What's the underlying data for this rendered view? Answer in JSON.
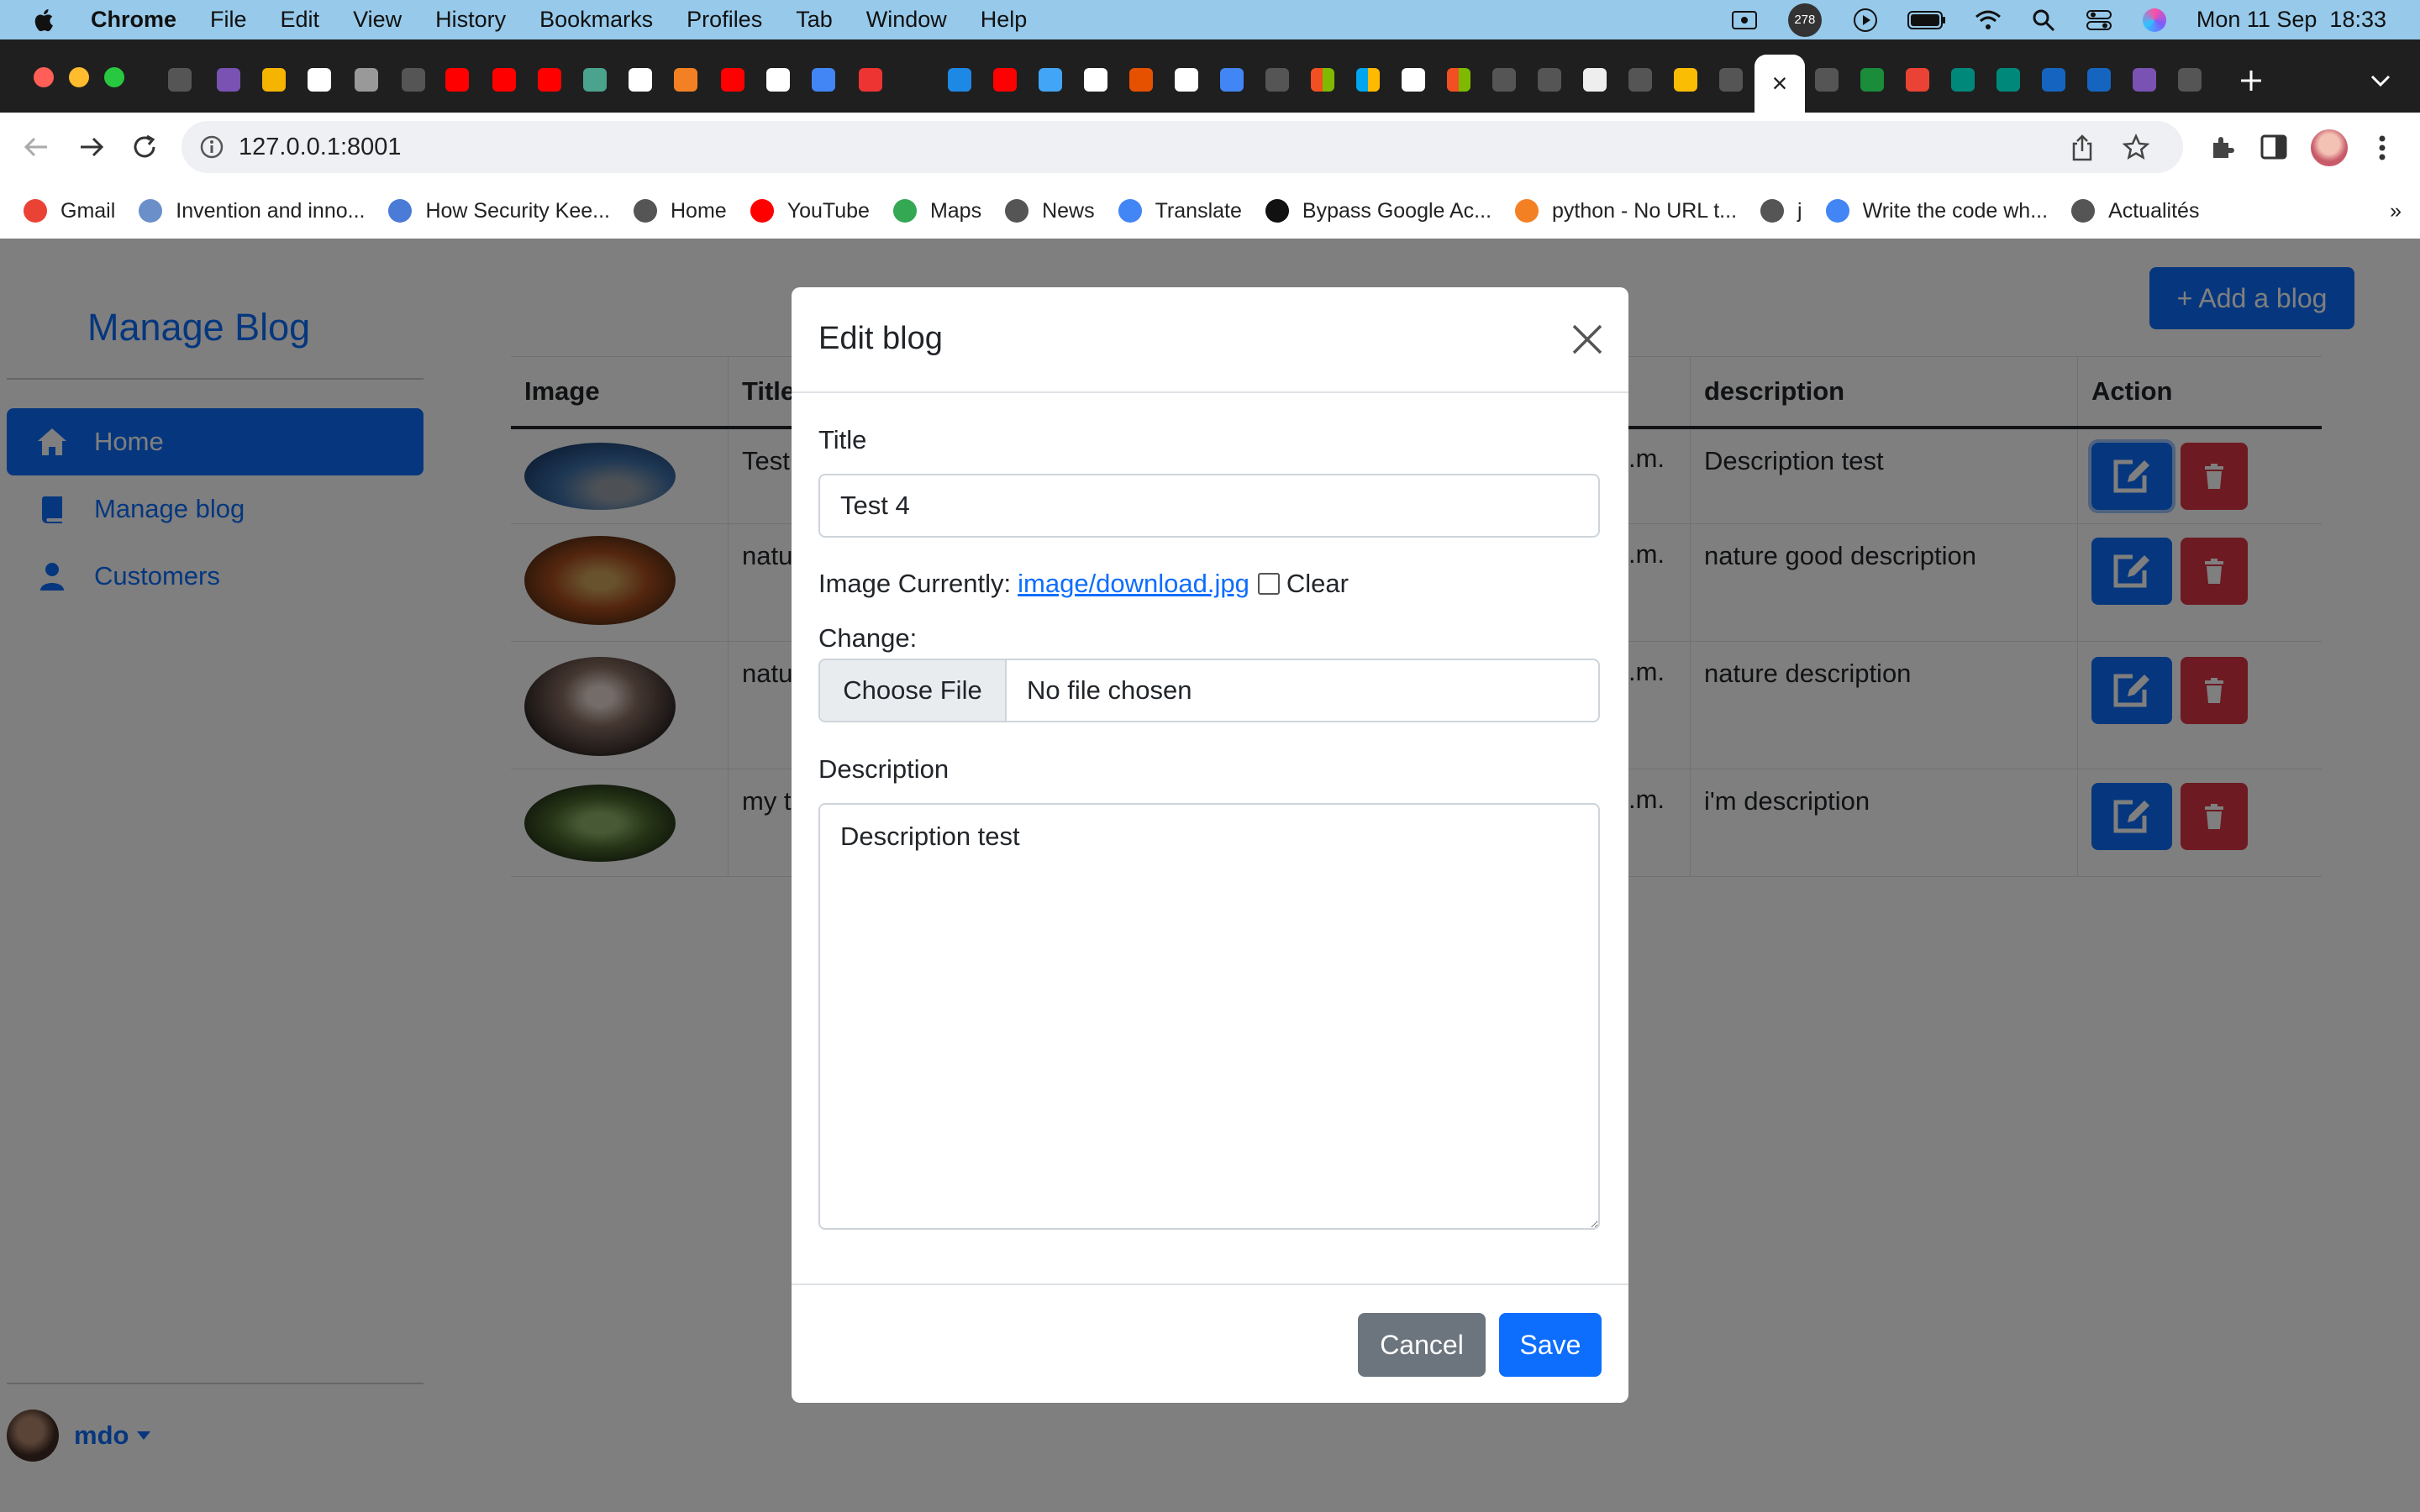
{
  "menubar": {
    "items": [
      "Chrome",
      "File",
      "Edit",
      "View",
      "History",
      "Bookmarks",
      "Profiles",
      "Tab",
      "Window",
      "Help"
    ],
    "badge": "278",
    "datetime": "Mon 11 Sep  18:33"
  },
  "browser": {
    "url": "127.0.0.1:8001",
    "active_tab_close": "×"
  },
  "bookmarks": [
    {
      "label": "Gmail",
      "color": "#ea4335"
    },
    {
      "label": "Invention and inno...",
      "color": "#6a8fc9"
    },
    {
      "label": "How Security Kee...",
      "color": "#4a7bd6"
    },
    {
      "label": "Home",
      "color": "#555"
    },
    {
      "label": "YouTube",
      "color": "#ff0000"
    },
    {
      "label": "Maps",
      "color": "#34a853"
    },
    {
      "label": "News",
      "color": "#555"
    },
    {
      "label": "Translate",
      "color": "#4285f4"
    },
    {
      "label": "Bypass Google Ac...",
      "color": "#111"
    },
    {
      "label": "python - No URL t...",
      "color": "#f48024"
    },
    {
      "label": "j",
      "color": "#555"
    },
    {
      "label": "Write the code wh...",
      "color": "#4285f4"
    },
    {
      "label": "Actualités",
      "color": "#555"
    }
  ],
  "bookmarks_more": "»",
  "sidebar": {
    "brand": "Manage Blog",
    "items": [
      {
        "label": "Home",
        "icon": "home-icon",
        "active": true
      },
      {
        "label": "Manage blog",
        "icon": "book-icon",
        "active": false
      },
      {
        "label": "Customers",
        "icon": "person-icon",
        "active": false
      }
    ],
    "user": "mdo"
  },
  "main": {
    "add_button": "+ Add a blog",
    "table": {
      "headers": [
        "Image",
        "Title",
        "",
        "description",
        "Action"
      ],
      "rows": [
        {
          "title": "Test",
          "date": ".m.",
          "description": "Description test"
        },
        {
          "title": "natu",
          "date": ".m.",
          "description": "nature good description"
        },
        {
          "title": "natu",
          "date": ".m.",
          "description": "nature description"
        },
        {
          "title": "my t",
          "date": ".m.",
          "description": "i'm description"
        }
      ]
    }
  },
  "modal": {
    "title": "Edit blog",
    "title_label": "Title",
    "title_value": "Test 4",
    "image_currently_label": "Image Currently:",
    "image_link": "image/download.jpg",
    "clear_label": "Clear",
    "change_label": "Change:",
    "choose_file": "Choose File",
    "no_file": "No file chosen",
    "description_label": "Description",
    "description_value": "Description test",
    "cancel": "Cancel",
    "save": "Save"
  },
  "colors": {
    "primary": "#0d6efd",
    "danger": "#dc3545",
    "secondary": "#6c757d",
    "menubar": "#96c9ea",
    "tabstrip": "#1f1f1f"
  }
}
